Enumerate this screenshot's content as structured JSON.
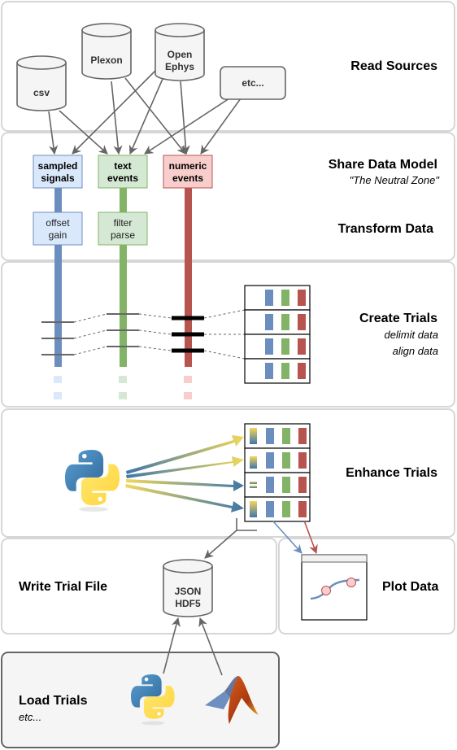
{
  "panels": {
    "read_sources": {
      "title": "Read Sources"
    },
    "share_data_model": {
      "title": "Share Data Model",
      "subtitle": "\"The Neutral Zone\""
    },
    "transform_data": {
      "title": "Transform Data"
    },
    "create_trials": {
      "title": "Create Trials",
      "lines": [
        "delimit data",
        "align data"
      ]
    },
    "enhance_trials": {
      "title": "Enhance Trials"
    },
    "write_trial_file": {
      "title": "Write Trial File"
    },
    "plot_data": {
      "title": "Plot Data"
    },
    "load_trials": {
      "title": "Load Trials",
      "subtitle": "etc..."
    }
  },
  "sources": [
    {
      "name": "csv",
      "lines": [
        "csv"
      ],
      "shape": "cylinder"
    },
    {
      "name": "plexon",
      "lines": [
        "Plexon"
      ],
      "shape": "cylinder"
    },
    {
      "name": "open-ephys",
      "lines": [
        "Open",
        "Ephys"
      ],
      "shape": "cylinder"
    },
    {
      "name": "etc",
      "lines": [
        "etc..."
      ],
      "shape": "rounded-box"
    }
  ],
  "data_model": [
    {
      "name": "sampled-signals",
      "lines": [
        "sampled",
        "signals"
      ],
      "color": "#6c8ebf",
      "fill": "#dae8fc"
    },
    {
      "name": "text-events",
      "lines": [
        "text",
        "events"
      ],
      "color": "#82b366",
      "fill": "#d5e8d4"
    },
    {
      "name": "numeric-events",
      "lines": [
        "numeric",
        "events"
      ],
      "color": "#b85450",
      "fill": "#f8cecc"
    }
  ],
  "transforms": [
    {
      "name": "offset-gain",
      "lines": [
        "offset",
        "gain"
      ]
    },
    {
      "name": "filter-parse",
      "lines": [
        "filter",
        "parse"
      ]
    }
  ],
  "trial_file": {
    "lines": [
      "JSON",
      "HDF5"
    ]
  },
  "icons": {
    "python": "python-logo-icon",
    "matlab": "matlab-logo-icon"
  },
  "colors": {
    "blue": "#6c8ebf",
    "green": "#82b366",
    "red": "#b85450",
    "yellow": "#f5d55a",
    "panel_border": "#d6d6d6",
    "node_fill": "#f5f5f5",
    "node_stroke": "#666666"
  }
}
